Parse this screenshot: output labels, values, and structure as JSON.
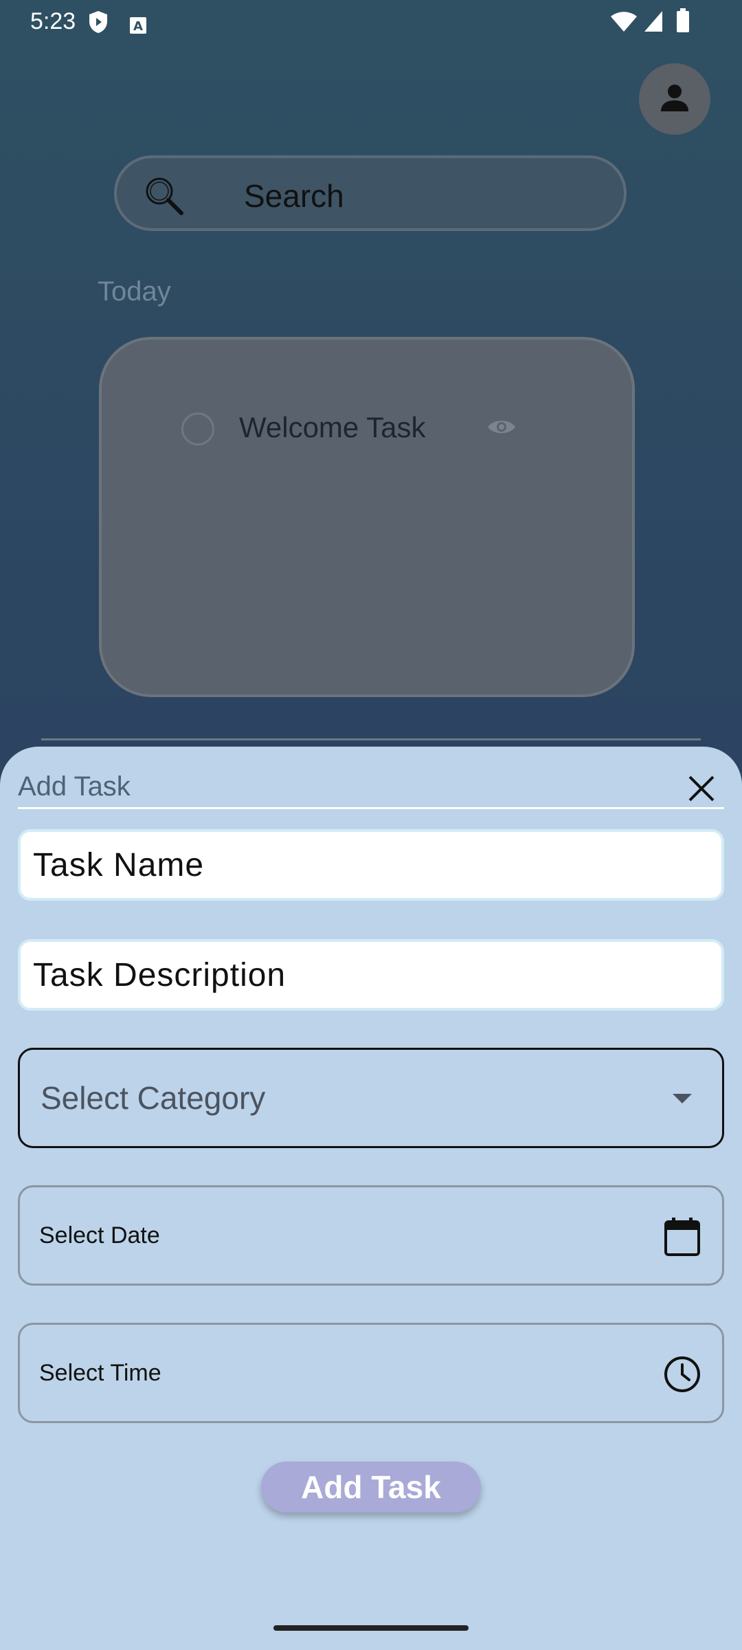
{
  "status_bar": {
    "time": "5:23"
  },
  "search": {
    "placeholder": "Search"
  },
  "sections": {
    "today_label": "Today"
  },
  "tasks": [
    {
      "name": "Welcome Task"
    }
  ],
  "sheet": {
    "title": "Add Task",
    "task_name_placeholder": "Task Name",
    "task_description_placeholder": "Task Description",
    "category_placeholder": "Select Category",
    "date_label": "Select Date",
    "time_label": "Select Time",
    "submit_label": "Add Task"
  },
  "icons": {
    "profile": "person-icon",
    "search": "search-icon",
    "view": "eye-icon",
    "close": "close-icon",
    "dropdown": "dropdown-arrow-icon",
    "calendar": "calendar-icon",
    "clock": "clock-icon"
  },
  "colors": {
    "sheet_background": "#bcd3e9",
    "submit_button": "#a9aad8",
    "background_top": "#2f5063",
    "background_bottom": "#2c3b5f"
  }
}
